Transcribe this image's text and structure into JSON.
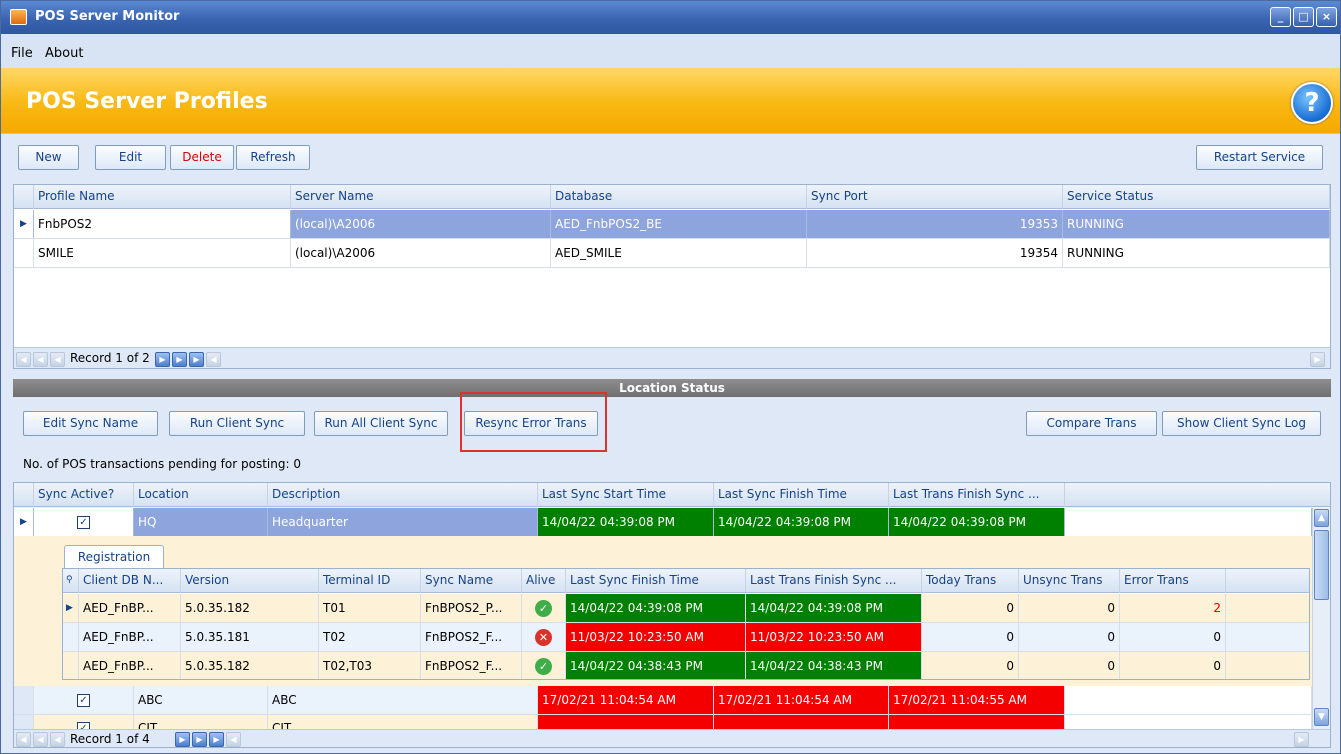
{
  "window": {
    "title": "POS Server Monitor",
    "controls": [
      "minimize-icon",
      "maximize-icon",
      "close-icon"
    ]
  },
  "menu": {
    "file": "File",
    "about": "About"
  },
  "banner": {
    "title": "POS Server Profiles",
    "help_symbol": "?"
  },
  "profile_toolbar": {
    "new": "New",
    "edit": "Edit",
    "delete": "Delete",
    "refresh": "Refresh",
    "restart": "Restart Service"
  },
  "profiles": {
    "columns": [
      "Profile Name",
      "Server Name",
      "Database",
      "Sync Port",
      "Service Status"
    ],
    "rows": [
      {
        "name": "FnbPOS2",
        "server": "(local)\\A2006",
        "database": "AED_FnbPOS2_BE",
        "port": "19353",
        "status": "RUNNING",
        "selected": true
      },
      {
        "name": "SMILE",
        "server": "(local)\\A2006",
        "database": "AED_SMILE",
        "port": "19354",
        "status": "RUNNING",
        "selected": false
      }
    ],
    "record_text": "Record 1 of 2"
  },
  "location": {
    "section_title": "Location Status",
    "buttons": {
      "edit_sync_name": "Edit Sync Name",
      "run_client_sync": "Run Client Sync",
      "run_all_client_sync": "Run All Client Sync",
      "resync_error_trans": "Resync Error Trans",
      "compare_trans": "Compare Trans",
      "show_client_sync_log": "Show Client Sync Log"
    },
    "pending_text": "No. of POS transactions pending for posting: 0",
    "columns": [
      "Sync Active?",
      "Location",
      "Description",
      "Last Sync Start Time",
      "Last Sync Finish Time",
      "Last Trans Finish Sync ..."
    ],
    "rows": [
      {
        "active": "✓",
        "location": "HQ",
        "description": "Headquarter",
        "start": "14/04/22 04:39:08 PM",
        "finish": "14/04/22 04:39:08 PM",
        "trans": "14/04/22 04:39:08 PM"
      },
      {
        "active": "✓",
        "location": "ABC",
        "description": "ABC",
        "start": "17/02/21 11:04:54 AM",
        "finish": "17/02/21 11:04:54 AM",
        "trans": "17/02/21 11:04:55 AM"
      },
      {
        "active": "✓",
        "location": "CIT",
        "description": "CIT",
        "start": "",
        "finish": "",
        "trans": ""
      }
    ],
    "record_text": "Record 1 of 4",
    "detail": {
      "tab": "Registration",
      "columns": [
        "Client DB N...",
        "Version",
        "Terminal ID",
        "Sync Name",
        "Alive",
        "Last Sync Finish Time",
        "Last Trans Finish Sync ...",
        "Today Trans",
        "Unsync Trans",
        "Error Trans"
      ],
      "rows": [
        {
          "db": "AED_FnBP...",
          "version": "5.0.35.182",
          "terminal": "T01",
          "sync": "FnBPOS2_P...",
          "alive": "ok",
          "finish": "14/04/22 04:39:08 PM",
          "trans": "14/04/22 04:39:08 PM",
          "today": "0",
          "unsync": "0",
          "error": "2"
        },
        {
          "db": "AED_FnBP...",
          "version": "5.0.35.181",
          "terminal": "T02",
          "sync": "FnBPOS2_F...",
          "alive": "error",
          "finish": "11/03/22 10:23:50 AM",
          "trans": "11/03/22 10:23:50 AM",
          "today": "0",
          "unsync": "0",
          "error": "0"
        },
        {
          "db": "AED_FnBP...",
          "version": "5.0.35.182",
          "terminal": "T02,T03",
          "sync": "FnBPOS2_F...",
          "alive": "ok",
          "finish": "14/04/22 04:38:43 PM",
          "trans": "14/04/22 04:38:43 PM",
          "today": "0",
          "unsync": "0",
          "error": "0"
        }
      ]
    }
  },
  "colors": {
    "ok": "#008000",
    "error": "#f40000",
    "highlight": "#e03030",
    "selected": "#8da4dc"
  }
}
